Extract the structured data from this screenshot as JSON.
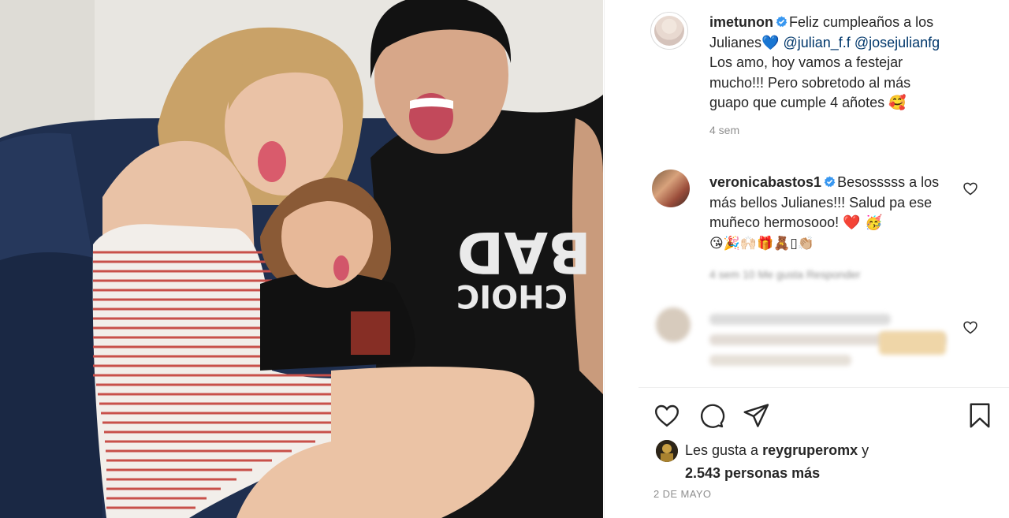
{
  "post": {
    "image_alt": "Foto de familia sacando la lengua en un sillón azul",
    "shirt_word_1": "BAD",
    "shirt_word_2": "CHOIC"
  },
  "caption": {
    "username": "imetunon",
    "text_before": "Feliz cumpleaños a los Julianes",
    "heart_emoji": "💙",
    "mention_1": "@julian_f.f",
    "mention_2": "@josejulianfg",
    "text_after": "Los amo, hoy vamos a festejar mucho!!! Pero sobretodo al más guapo que cumple 4 añotes",
    "end_emoji": "🥰",
    "time": "4 sem"
  },
  "comments": [
    {
      "username": "veronicabastos1",
      "text": "Besosssss a los más bellos Julianes!!! Salud pa ese muñeco hermosooo!",
      "emojis_line_1": "❤️ 🥳",
      "emojis_line_2": "😘🎉🙌🏻🎁🧸▯👏🏼",
      "meta": "4 sem    10 Me gusta    Responder"
    }
  ],
  "likes": {
    "prefix": "Les gusta a",
    "user": "reygruperomx",
    "connector": "y",
    "count": "2.543 personas más"
  },
  "date": "2 DE MAYO",
  "icons": {
    "like": "heart-outline-icon",
    "comment": "comment-bubble-icon",
    "share": "paper-plane-icon",
    "save": "bookmark-icon",
    "verified": "verified-badge-icon",
    "comment_like": "heart-outline-icon"
  },
  "colors": {
    "text": "#262626",
    "muted": "#8e8e8e",
    "link": "#00376b",
    "verified": "#3897f0",
    "border": "#efefef"
  }
}
